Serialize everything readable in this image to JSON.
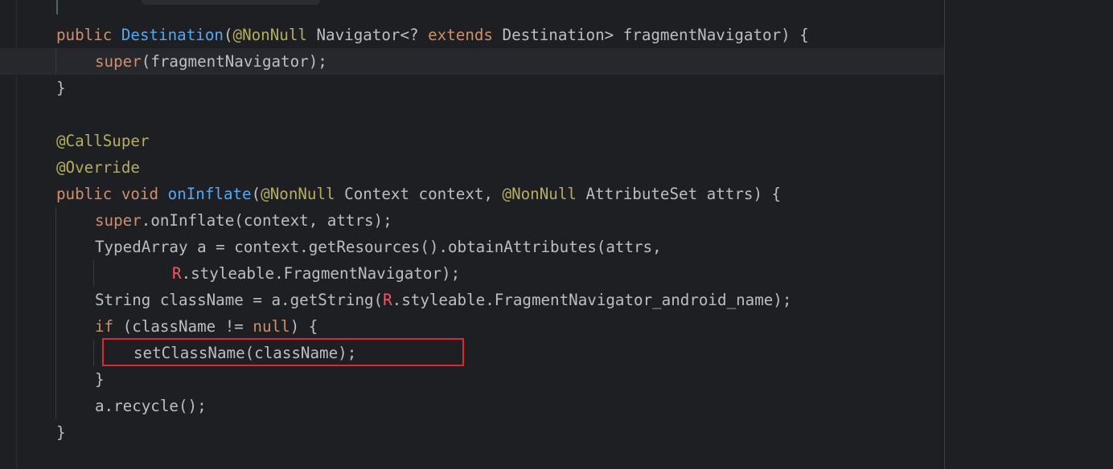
{
  "code": {
    "line_ctor_sig": {
      "kw_public": "public",
      "name": "Destination",
      "paren_open": "(",
      "ann": "@NonNull",
      "type_part": " Navigator<? ",
      "kw_extends": "extends",
      "rest": " Destination> fragmentNavigator) {"
    },
    "line_super_call": {
      "kw_super": "super",
      "rest": "(fragmentNavigator);"
    },
    "line_ctor_close": "}",
    "line_callsuper": "@CallSuper",
    "line_override": "@Override",
    "line_oninflate_sig": {
      "kw_public_void": "public void",
      "name": "onInflate",
      "paren_open": "(",
      "ann1": "@NonNull",
      "mid": " Context context, ",
      "ann2": "@NonNull",
      "rest": " AttributeSet attrs) {"
    },
    "line_super_inflate": {
      "kw_super": "super",
      "rest": ".onInflate(context, attrs);"
    },
    "line_typed_array": "TypedArray a = context.getResources().obtainAttributes(attrs,",
    "line_styleable": {
      "r": "R",
      "rest": ".styleable.FragmentNavigator);"
    },
    "line_string_classname": {
      "before": "String className = a.getString(",
      "r": "R",
      "after": ".styleable.FragmentNavigator_android_name);"
    },
    "line_if": {
      "kw_if": "if",
      "mid": " (className != ",
      "kw_null": "null",
      "rest": ") {"
    },
    "line_setclassname": "setClassName(className);",
    "line_if_close": "}",
    "line_recycle": "a.recycle();",
    "line_method_close": "}"
  }
}
